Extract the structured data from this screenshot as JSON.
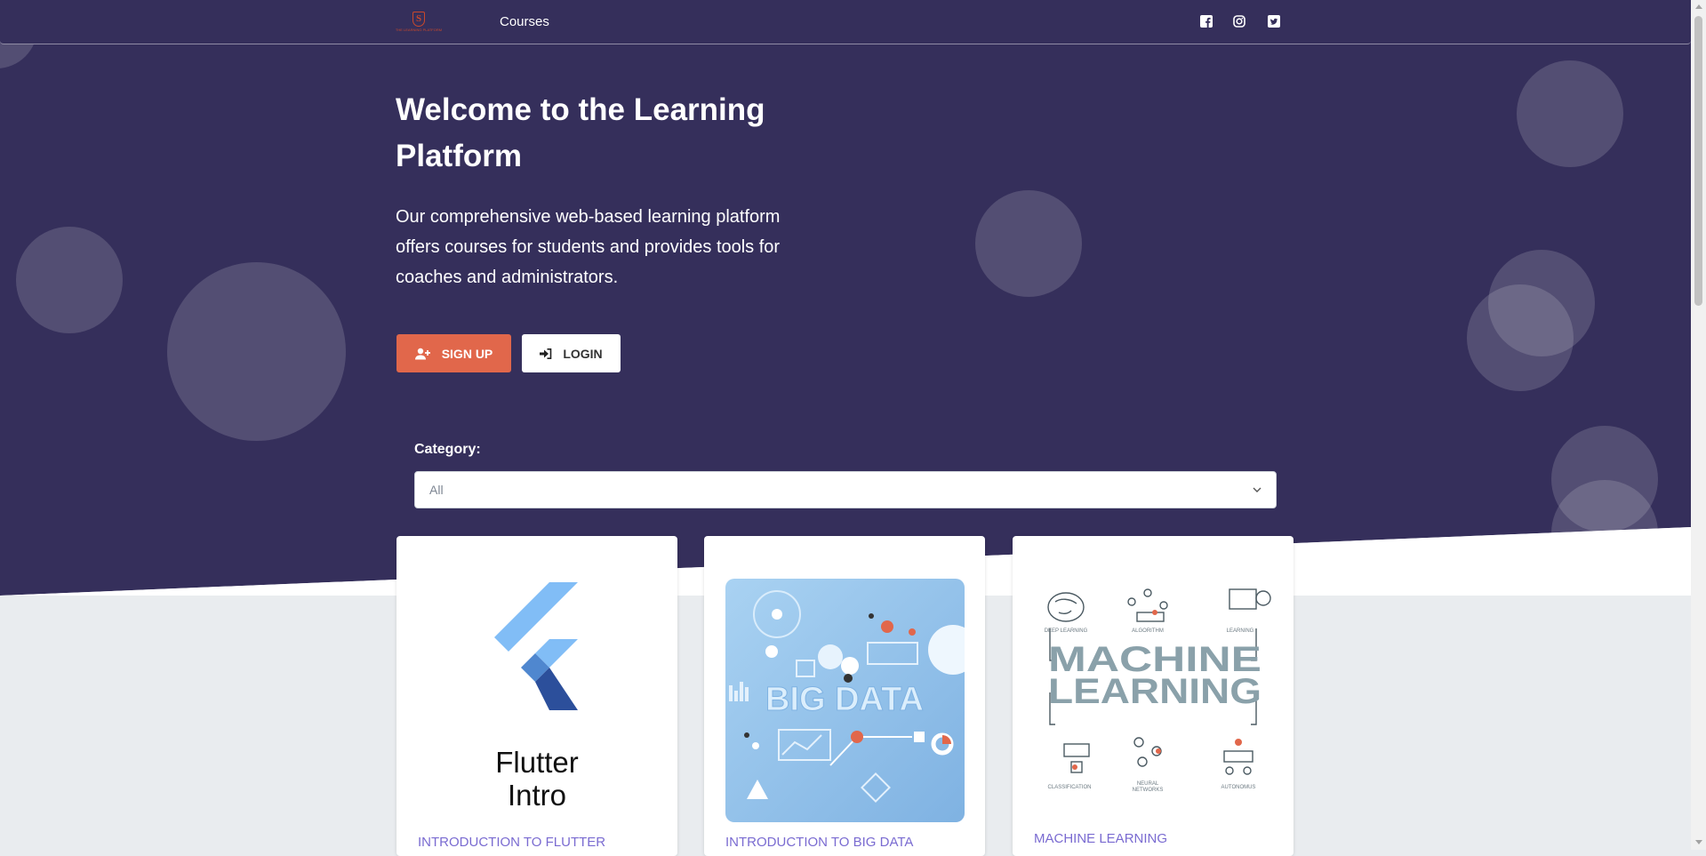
{
  "navbar": {
    "logo_letter": "S",
    "logo_tagline": "THE LEARNING PLATFORM",
    "courses_link": "Courses",
    "social": [
      "facebook-icon",
      "instagram-icon",
      "twitter-icon"
    ]
  },
  "hero": {
    "title": "Welcome to the Learning Platform",
    "description": "Our comprehensive web-based learning platform offers courses for students and provides tools for coaches and administrators.",
    "signup_label": "SIGN UP",
    "login_label": "LOGIN"
  },
  "filter": {
    "label": "Category:",
    "selected": "All"
  },
  "courses": [
    {
      "image_text": "Flutter Intro",
      "title": "INTRODUCTION TO FLUTTER"
    },
    {
      "image_text": "BIG DATA",
      "title": "INTRODUCTION TO BIG DATA"
    },
    {
      "image_text": "MACHINE LEARNING",
      "title": "MACHINE LEARNING",
      "image_labels": [
        "DEEP LEARNING",
        "ALGORITHM",
        "LEARNING",
        "CLASSIFICATION",
        "NEURAL NETWORKS",
        "AUTONOMUS"
      ]
    }
  ],
  "colors": {
    "hero_bg": "#352f5b",
    "accent": "#e1674b",
    "course_title": "#7a6bd1",
    "page_bg": "#e9ecef"
  }
}
